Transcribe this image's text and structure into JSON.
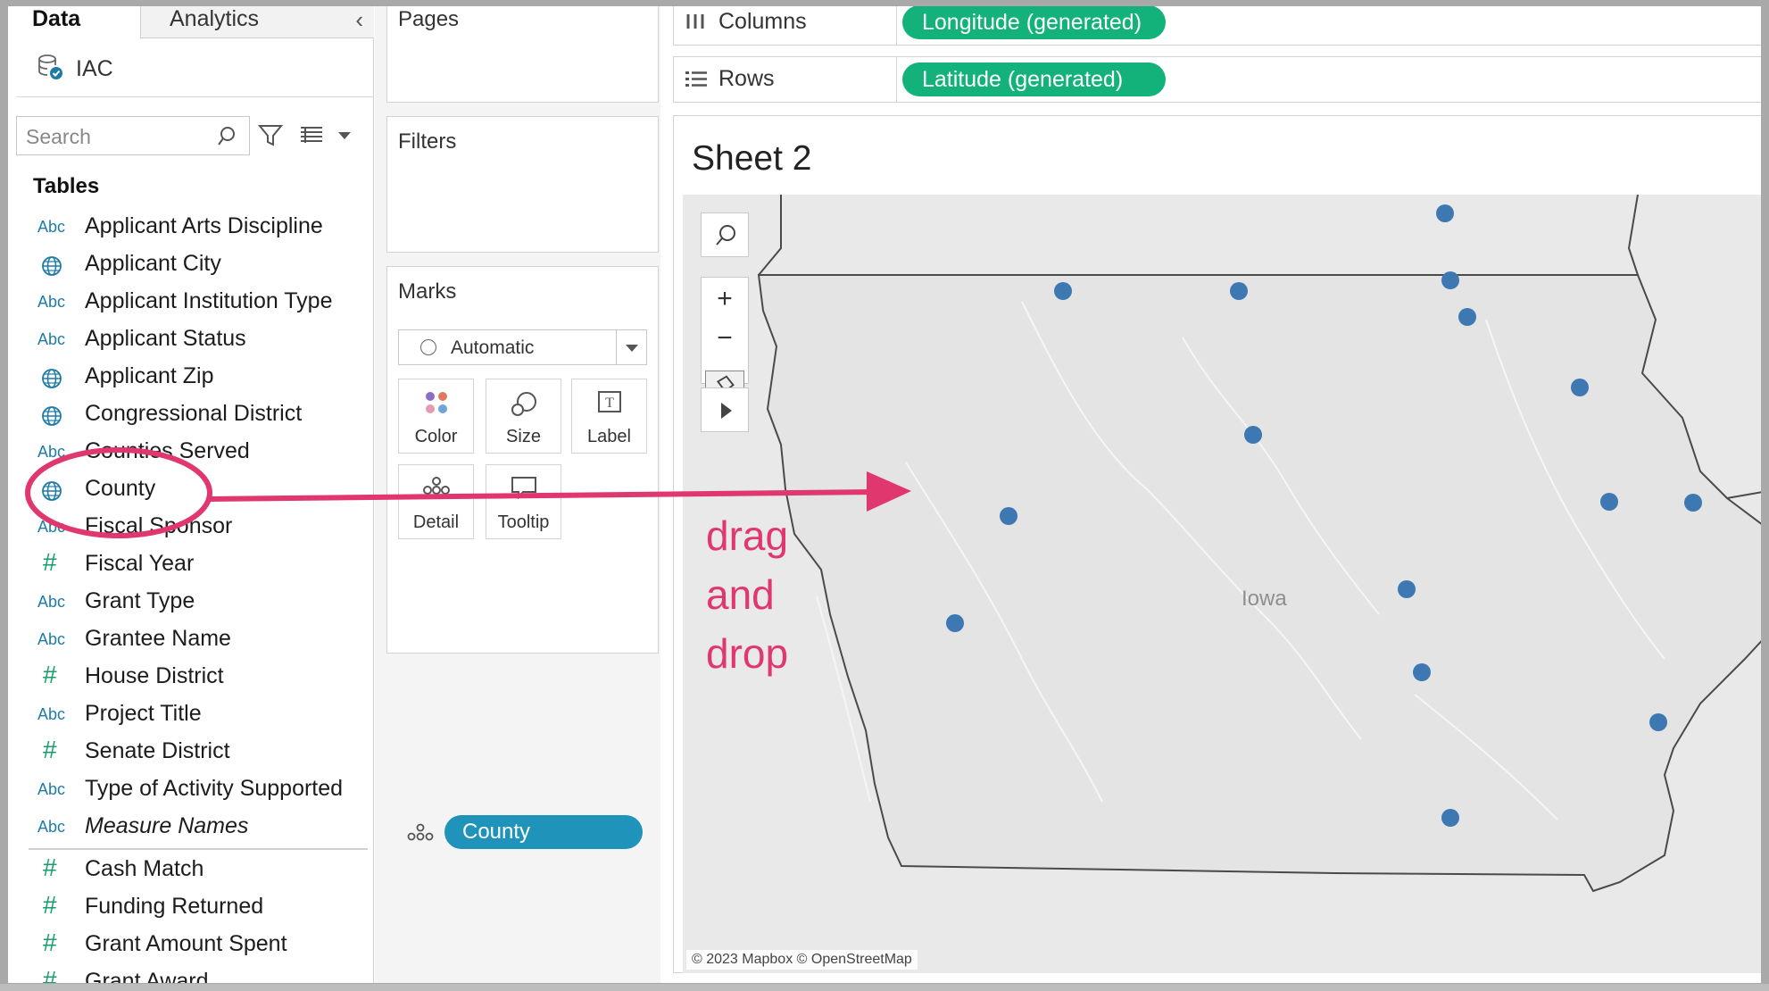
{
  "left_pane": {
    "tab_data": "Data",
    "tab_analytics": "Analytics",
    "datasource": "IAC",
    "search": {
      "placeholder": "Search"
    },
    "tables_heading": "Tables",
    "fields": [
      {
        "type": "Abc",
        "kind": "text",
        "name": "Applicant Arts Discipline"
      },
      {
        "type": "geo",
        "kind": "geo",
        "name": "Applicant City"
      },
      {
        "type": "Abc",
        "kind": "text",
        "name": "Applicant Institution Type"
      },
      {
        "type": "Abc",
        "kind": "text",
        "name": "Applicant Status"
      },
      {
        "type": "geo",
        "kind": "geo",
        "name": "Applicant Zip"
      },
      {
        "type": "geo",
        "kind": "geo",
        "name": "Congressional District"
      },
      {
        "type": "Abc",
        "kind": "text",
        "name": "Counties Served"
      },
      {
        "type": "geo",
        "kind": "geo",
        "name": "County"
      },
      {
        "type": "Abc",
        "kind": "text",
        "name": "Fiscal Sponsor"
      },
      {
        "type": "#",
        "kind": "num",
        "name": "Fiscal Year"
      },
      {
        "type": "Abc",
        "kind": "text",
        "name": "Grant Type"
      },
      {
        "type": "Abc",
        "kind": "text",
        "name": "Grantee Name"
      },
      {
        "type": "#",
        "kind": "num",
        "name": "House District"
      },
      {
        "type": "Abc",
        "kind": "text",
        "name": "Project Title"
      },
      {
        "type": "#",
        "kind": "num",
        "name": "Senate District"
      },
      {
        "type": "Abc",
        "kind": "text",
        "name": "Type of Activity Supported"
      },
      {
        "type": "Abc",
        "kind": "text",
        "name": "Measure Names"
      }
    ],
    "measures": [
      {
        "type": "#",
        "name": "Cash Match"
      },
      {
        "type": "#",
        "name": "Funding Returned"
      },
      {
        "type": "#",
        "name": "Grant Amount Spent"
      },
      {
        "type": "#",
        "name": "Grant Award"
      }
    ]
  },
  "shelves": {
    "pages_title": "Pages",
    "filters_title": "Filters",
    "marks_title": "Marks",
    "mark_type": "Automatic",
    "mark_buttons": {
      "color": "Color",
      "size": "Size",
      "label": "Label",
      "detail": "Detail",
      "tooltip": "Tooltip"
    },
    "detail_pill": "County",
    "columns_label": "Columns",
    "columns_pill": "Longitude (generated)",
    "rows_label": "Rows",
    "rows_pill": "Latitude (generated)"
  },
  "view": {
    "sheet_title": "Sheet 2",
    "map_label": "Iowa",
    "attribution": "© 2023 Mapbox © OpenStreetMap"
  },
  "annotation": {
    "line1": "drag",
    "line2": "and",
    "line3": "drop",
    "color": "#e0376f"
  },
  "colors": {
    "mark_dot": "#3e78b2",
    "green_pill": "#12b27a",
    "blue_pill": "#1f93ba"
  }
}
